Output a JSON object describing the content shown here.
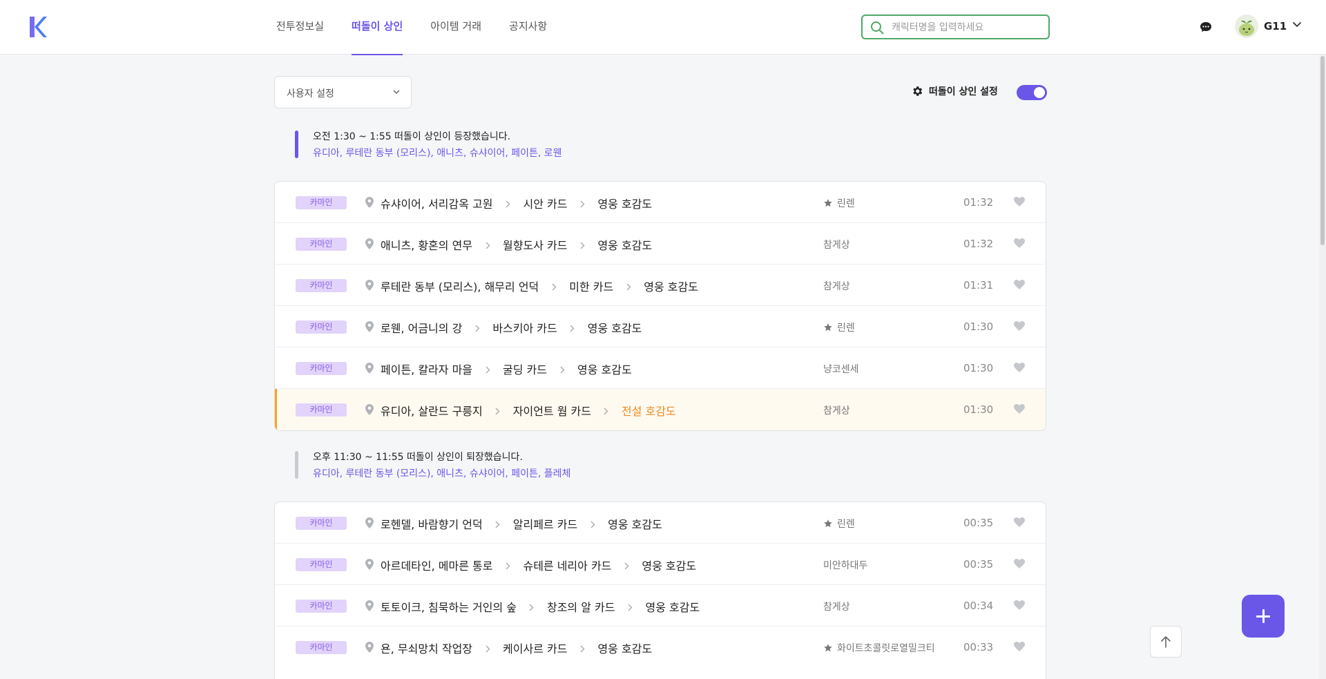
{
  "brand": {
    "logo_letter": "K",
    "accent": "#6a57e8"
  },
  "nav": {
    "items": [
      {
        "label": "전투정보실",
        "active": false
      },
      {
        "label": "떠돌이 상인",
        "active": true
      },
      {
        "label": "아이템 거래",
        "active": false
      },
      {
        "label": "공지사항",
        "active": false
      }
    ]
  },
  "search": {
    "placeholder": "캐릭터명을 입력하세요",
    "value": ""
  },
  "user": {
    "name": "G11"
  },
  "filter": {
    "dropdown_label": "사용자 설정"
  },
  "merchant_setting": {
    "label": "떠돌이 상인 설정",
    "enabled": true
  },
  "notices": [
    {
      "text": "오전 1:30 ~ 1:55 떠돌이 상인이 등장했습니다.",
      "regions": "유디아, 루테란 동부 (모리스), 애니츠, 슈샤이어, 페이튼, 로웬",
      "status": "active"
    },
    {
      "text": "오후 11:30 ~ 11:55 떠돌이 상인이 퇴장했습니다.",
      "regions": "유디아, 루테란 동부 (모리스), 애니츠, 슈샤이어, 페이튼, 플레체",
      "status": "ended"
    }
  ],
  "groups": [
    {
      "rows": [
        {
          "badge": "카마인",
          "location": "슈샤이어, 서리감옥 고원",
          "card": "시안 카드",
          "rapport": "영웅 호감도",
          "legend": false,
          "server": "린렌",
          "starred": true,
          "time": "01:32"
        },
        {
          "badge": "카마인",
          "location": "애니츠, 황혼의 연무",
          "card": "월향도사 카드",
          "rapport": "영웅 호감도",
          "legend": false,
          "server": "참게상",
          "starred": false,
          "time": "01:32"
        },
        {
          "badge": "카마인",
          "location": "루테란 동부 (모리스), 해무리 언덕",
          "card": "미한 카드",
          "rapport": "영웅 호감도",
          "legend": false,
          "server": "참게상",
          "starred": false,
          "time": "01:31"
        },
        {
          "badge": "카마인",
          "location": "로웬, 어금니의 강",
          "card": "바스키아 카드",
          "rapport": "영웅 호감도",
          "legend": false,
          "server": "린렌",
          "starred": true,
          "time": "01:30"
        },
        {
          "badge": "카마인",
          "location": "페이튼, 칼라자 마을",
          "card": "굴딩 카드",
          "rapport": "영웅 호감도",
          "legend": false,
          "server": "냥코센세",
          "starred": false,
          "time": "01:30"
        },
        {
          "badge": "카마인",
          "location": "유디아, 살란드 구릉지",
          "card": "자이언트 웜 카드",
          "rapport": "전설 호감도",
          "legend": true,
          "server": "참게상",
          "starred": false,
          "time": "01:30"
        }
      ]
    },
    {
      "rows": [
        {
          "badge": "카마인",
          "location": "로헨델, 바람향기 언덕",
          "card": "알리페르 카드",
          "rapport": "영웅 호감도",
          "legend": false,
          "server": "린렌",
          "starred": true,
          "time": "00:35"
        },
        {
          "badge": "카마인",
          "location": "아르데타인, 메마른 통로",
          "card": "슈테른 네리아 카드",
          "rapport": "영웅 호감도",
          "legend": false,
          "server": "미안하대두",
          "starred": false,
          "time": "00:35"
        },
        {
          "badge": "카마인",
          "location": "토토이크, 침묵하는 거인의 숲",
          "card": "창조의 알 카드",
          "rapport": "영웅 호감도",
          "legend": false,
          "server": "참게상",
          "starred": false,
          "time": "00:34"
        },
        {
          "badge": "카마인",
          "location": "욘, 무쇠망치 작업장",
          "card": "케이사르 카드",
          "rapport": "영웅 호감도",
          "legend": false,
          "server": "화이트초콜릿로열밀크티",
          "starred": true,
          "time": "00:33"
        }
      ]
    }
  ]
}
